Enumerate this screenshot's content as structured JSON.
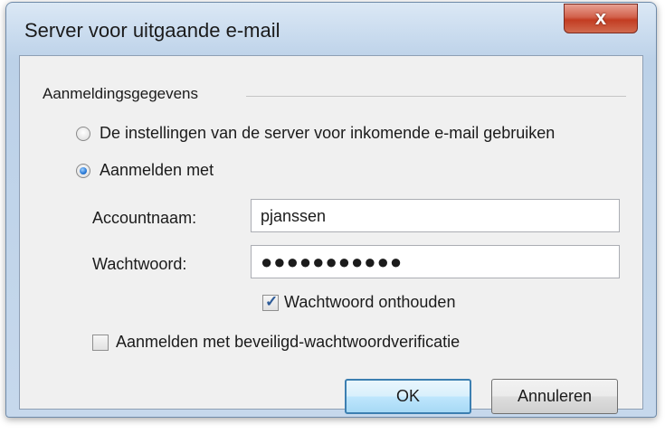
{
  "window": {
    "title": "Server voor uitgaande e-mail",
    "close_label": "x"
  },
  "credentials": {
    "group_label": "Aanmeldingsgegevens",
    "option_use_incoming": {
      "label": "De instellingen van de server voor inkomende e-mail gebruiken",
      "selected": false
    },
    "option_login_with": {
      "label": "Aanmelden met",
      "selected": true
    },
    "account_name": {
      "label": "Accountnaam:",
      "value": "pjanssen"
    },
    "password": {
      "label": "Wachtwoord:",
      "masked_value": "●●●●●●●●●●●"
    },
    "remember_password": {
      "label": "Wachtwoord onthouden",
      "checked": true,
      "check_glyph": "✓"
    },
    "secure_password_auth": {
      "label": "Aanmelden met beveiligd-wachtwoordverificatie",
      "checked": false
    }
  },
  "buttons": {
    "ok_label": "OK",
    "cancel_label": "Annuleren"
  },
  "colors": {
    "accent": "#2f7ed8",
    "close_button": "#c33c22",
    "dialog_background": "#f0f0f0"
  }
}
